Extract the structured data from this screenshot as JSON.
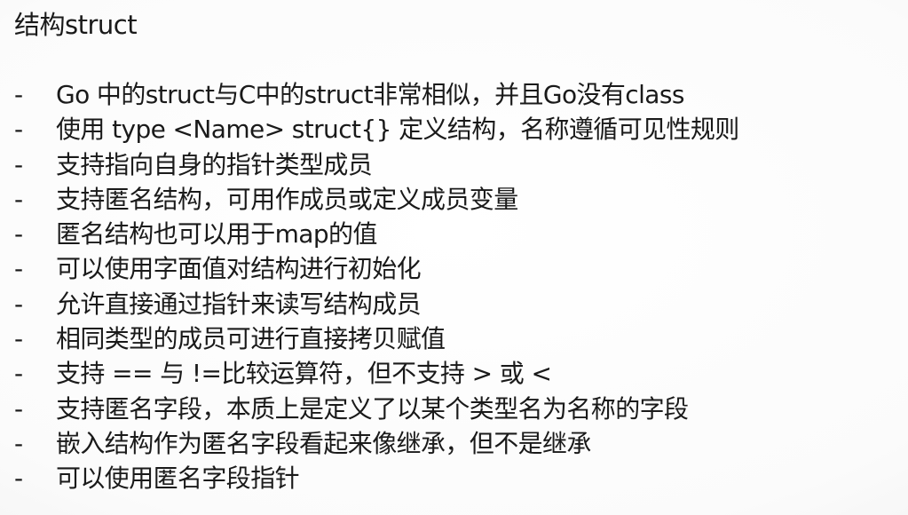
{
  "slide": {
    "title": "结构struct",
    "bullet_marker": "-",
    "bullets": [
      "Go 中的struct与C中的struct非常相似，并且Go没有class",
      "使用 type <Name> struct{} 定义结构，名称遵循可见性规则",
      "支持指向自身的指针类型成员",
      "支持匿名结构，可用作成员或定义成员变量",
      "匿名结构也可以用于map的值",
      "可以使用字面值对结构进行初始化",
      "允许直接通过指针来读写结构成员",
      "相同类型的成员可进行直接拷贝赋值",
      "支持 == 与 !=比较运算符，但不支持 > 或 <",
      "支持匿名字段，本质上是定义了以某个类型名为名称的字段",
      "嵌入结构作为匿名字段看起来像继承，但不是继承",
      "可以使用匿名字段指针"
    ]
  }
}
